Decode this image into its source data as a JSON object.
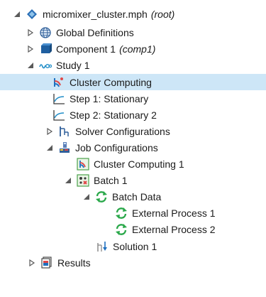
{
  "tree": {
    "root": {
      "label": "micromixer_cluster.mph",
      "tag": "(root)",
      "icon": "model-root-icon"
    },
    "global_definitions": {
      "label": "Global Definitions",
      "icon": "globe-icon"
    },
    "component": {
      "label": "Component 1",
      "tag": "(comp1)",
      "icon": "component-icon"
    },
    "study": {
      "label": "Study 1",
      "icon": "study-icon"
    },
    "cluster_computing": {
      "label": "Cluster Computing",
      "icon": "cluster-computing-icon",
      "selected": true
    },
    "step1": {
      "label": "Step 1: Stationary",
      "icon": "stationary-step-icon"
    },
    "step2": {
      "label": "Step 2: Stationary 2",
      "icon": "stationary-step-icon"
    },
    "solver_configurations": {
      "label": "Solver Configurations",
      "icon": "solver-configurations-icon"
    },
    "job_configurations": {
      "label": "Job Configurations",
      "icon": "job-configurations-icon"
    },
    "job_cluster_computing": {
      "label": "Cluster Computing 1",
      "icon": "cluster-computing-job-icon"
    },
    "batch": {
      "label": "Batch 1",
      "icon": "batch-icon"
    },
    "batch_data": {
      "label": "Batch Data",
      "icon": "refresh-icon"
    },
    "external_process_1": {
      "label": "External Process 1",
      "icon": "refresh-icon"
    },
    "external_process_2": {
      "label": "External Process 2",
      "icon": "refresh-icon"
    },
    "solution": {
      "label": "Solution 1",
      "icon": "solution-icon"
    },
    "results": {
      "label": "Results",
      "icon": "results-icon"
    }
  },
  "colors": {
    "selection": "#cde6f7",
    "expander": "#5a5a5a",
    "study_blue": "#1f8dc8",
    "refresh_green": "#2aa84a"
  }
}
